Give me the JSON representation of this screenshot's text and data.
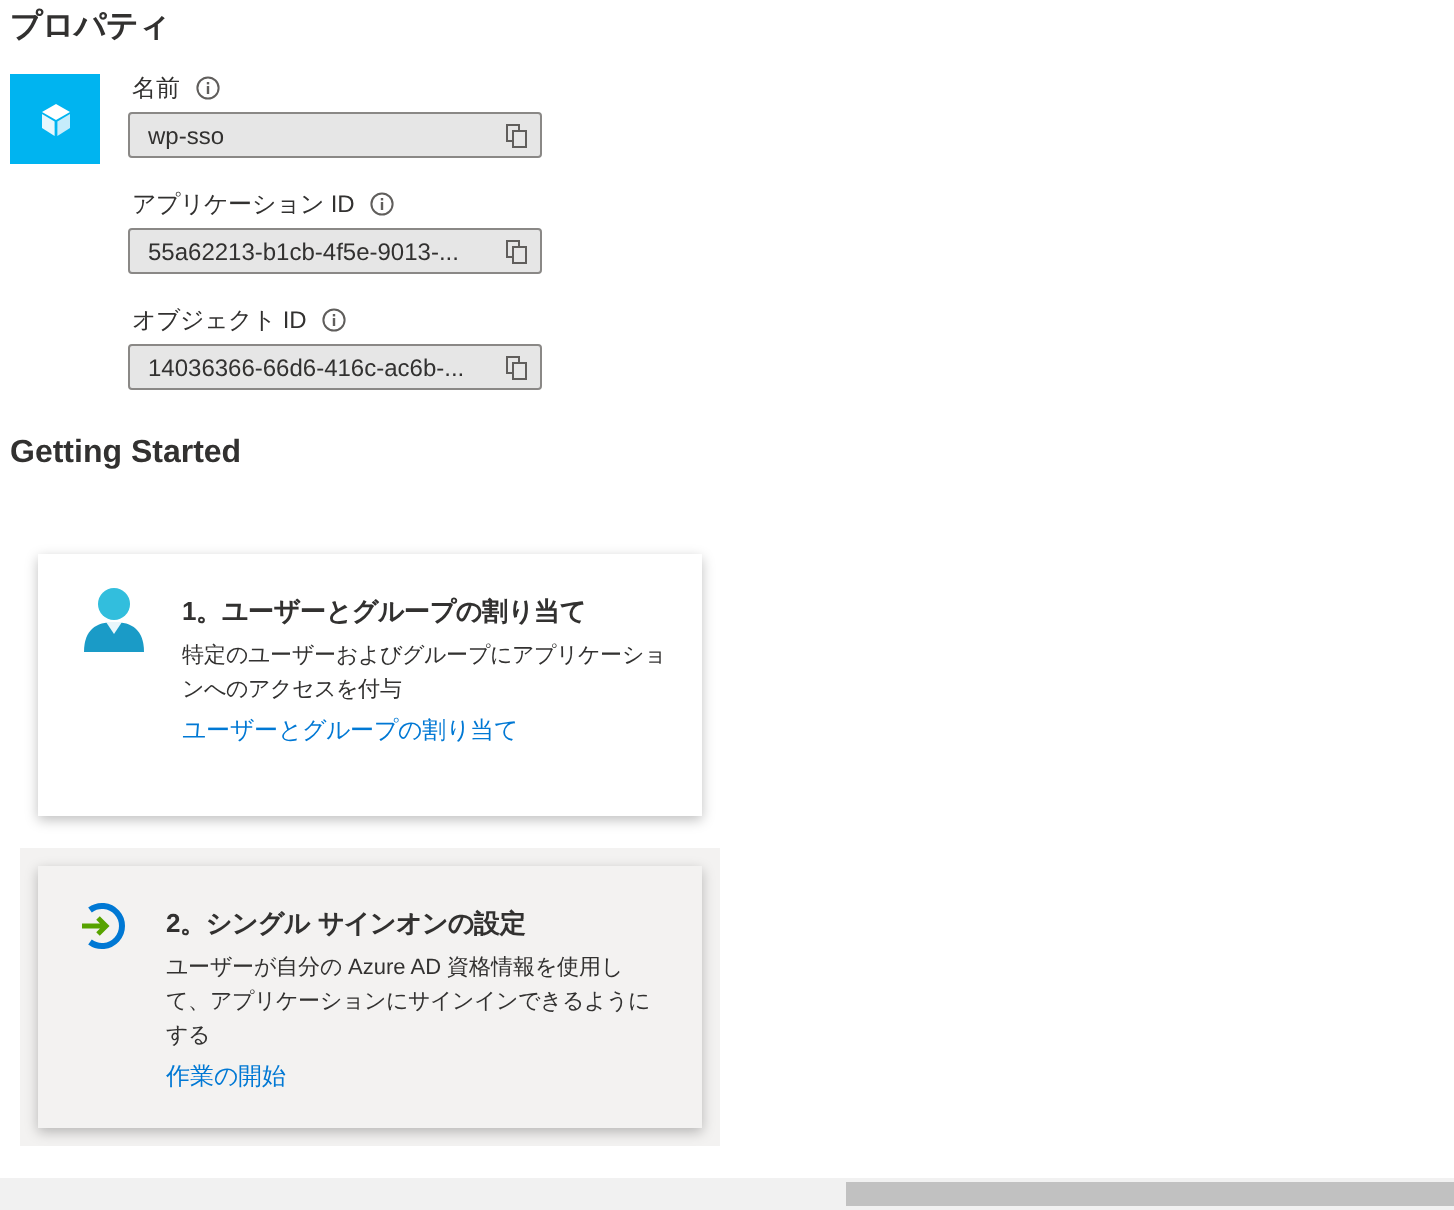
{
  "section_title": "プロパティ",
  "fields": [
    {
      "label": "名前",
      "value": "wp-sso"
    },
    {
      "label": "アプリケーション ID",
      "value": "55a62213-b1cb-4f5e-9013-..."
    },
    {
      "label": "オブジェクト ID",
      "value": "14036366-66d6-416c-ac6b-..."
    }
  ],
  "getting_started": {
    "title": "Getting Started",
    "cards": [
      {
        "kind": "users",
        "hovered": false,
        "title": "1。ユーザーとグループの割り当て",
        "description": "特定のユーザーおよびグループにアプリケーションへのアクセスを付与",
        "link": "ユーザーとグループの割り当て"
      },
      {
        "kind": "signin",
        "hovered": true,
        "title": "2。シングル サインオンの設定",
        "description": "ユーザーが自分の Azure AD 資格情報を使用して、アプリケーションにサインインできるようにする",
        "link": "作業の開始"
      }
    ]
  }
}
